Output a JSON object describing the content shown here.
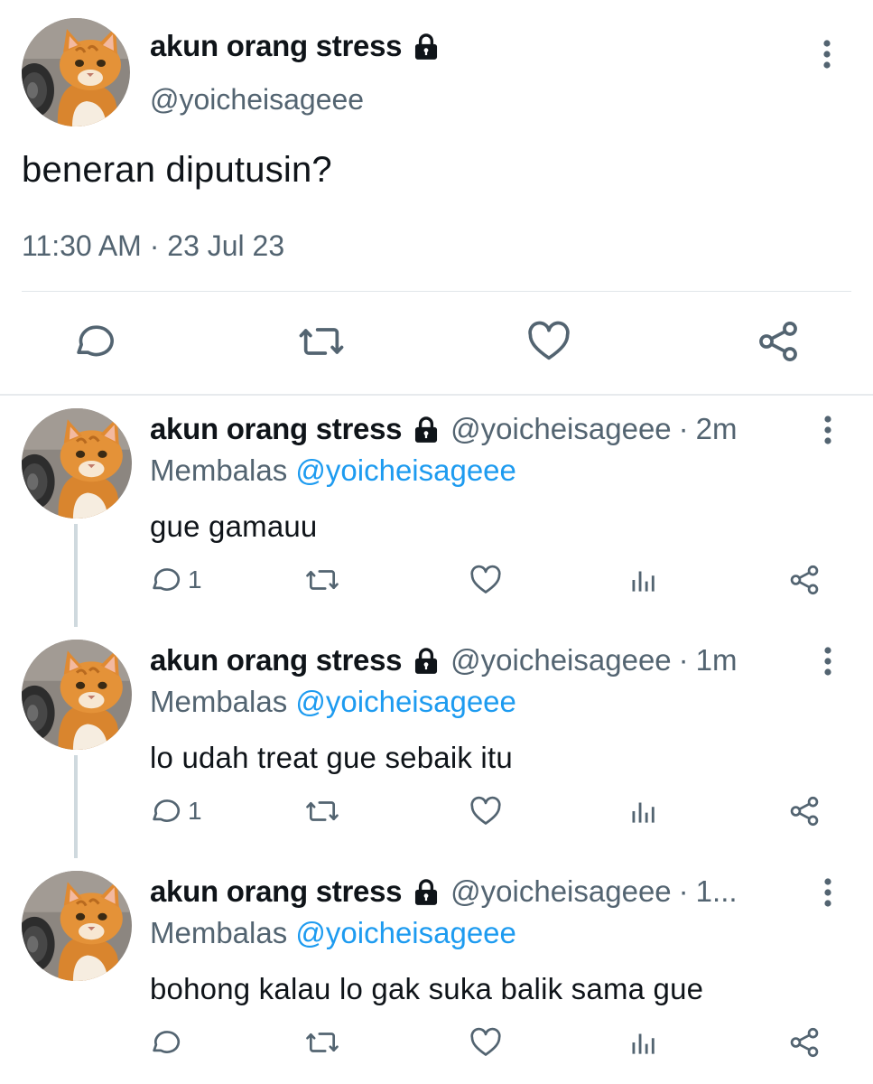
{
  "colors": {
    "accent": "#1d9bf0",
    "secondary_text": "#536471",
    "primary_text": "#0f1419"
  },
  "main_tweet": {
    "display_name": "akun orang stress",
    "handle": "@yoicheisageee",
    "text": "beneran diputusin?",
    "timestamp": "11:30 AM · 23 Jul 23",
    "icons": [
      "cat-avatar",
      "lock-icon",
      "more-icon",
      "reply-icon",
      "retweet-icon",
      "like-icon",
      "share-icon"
    ]
  },
  "replies": [
    {
      "display_name": "akun orang stress",
      "handle": "@yoicheisageee",
      "time_sep": "·",
      "time": "2m",
      "replying_prefix": "Membalas",
      "replying_to": "@yoicheisageee",
      "text": "gue gamauu",
      "reply_count": "1"
    },
    {
      "display_name": "akun orang stress",
      "handle": "@yoicheisageee",
      "time_sep": "·",
      "time": "1m",
      "replying_prefix": "Membalas",
      "replying_to": "@yoicheisageee",
      "text": "lo udah treat gue sebaik itu",
      "reply_count": "1"
    },
    {
      "display_name": "akun orang stress",
      "handle": "@yoicheisageee",
      "time_sep": "·",
      "time": "1...",
      "replying_prefix": "Membalas",
      "replying_to": "@yoicheisageee",
      "text": "bohong kalau lo gak suka balik sama gue",
      "reply_count": ""
    }
  ]
}
